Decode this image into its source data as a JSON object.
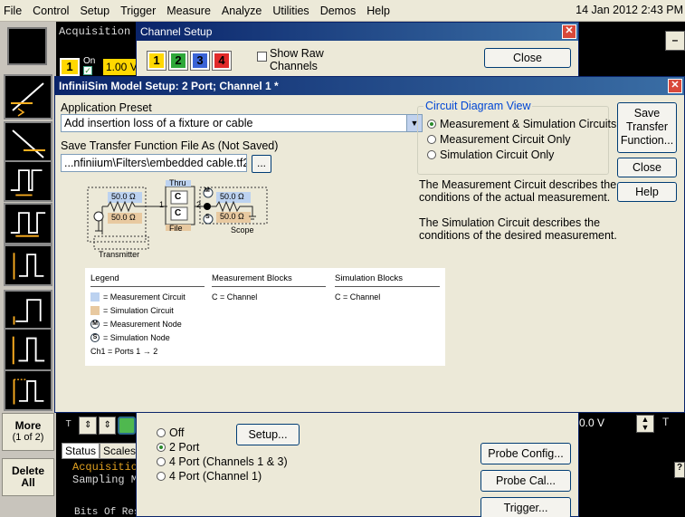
{
  "menu": {
    "items": [
      "File",
      "Control",
      "Setup",
      "Trigger",
      "Measure",
      "Analyze",
      "Utilities",
      "Demos",
      "Help"
    ],
    "datetime": "14 Jan 2012 2:43 PM"
  },
  "scope": {
    "acquisition_text": "Acquisition is",
    "ch1_number": "1",
    "ch1_on_label": "On",
    "ch1_scale": "1.00 V",
    "minimize": "–",
    "right_value": "0.0 V",
    "right_t": "T",
    "q_label": "?",
    "tabs": [
      "Status",
      "Scales"
    ],
    "status_lines": [
      "Acquisition",
      "Sampling Mo"
    ],
    "bits_line": "Bits Of Res"
  },
  "left_toolbar": {
    "more_label": "More",
    "more_sub": "(1 of 2)",
    "delete_label": "Delete",
    "delete_sub": "All"
  },
  "channel_setup": {
    "title": "Channel Setup",
    "channels": [
      "1",
      "2",
      "3",
      "4"
    ],
    "channel_colors": [
      "#ffd800",
      "#2ea83a",
      "#3a63d6",
      "#e12a2a"
    ],
    "show_raw_line1": "Show Raw",
    "show_raw_line2": "Channels",
    "close_label": "Close",
    "port_options": [
      "Off",
      "2 Port",
      "4 Port  (Channels 1 & 3)",
      "4 Port  (Channel 1)"
    ],
    "port_selected": "2 Port",
    "setup_label": "Setup...",
    "probe_config_label": "Probe Config...",
    "probe_cal_label": "Probe Cal...",
    "trigger_label": "Trigger..."
  },
  "infiniisim": {
    "title": "InfiniiSim Model Setup: 2 Port; Channel 1 *",
    "app_preset_label": "Application Preset",
    "app_preset_value": "Add insertion loss of a fixture or cable",
    "save_label": "Save Transfer Function File As (Not Saved)",
    "save_path": "...nfiniium\\Filters\\embedded cable.tf2",
    "browse_label": "...",
    "circuit_view_legend": "Circuit Diagram View",
    "circuit_view_options": [
      "Measurement & Simulation Circuits",
      "Measurement Circuit Only",
      "Simulation Circuit Only"
    ],
    "circuit_view_selected": "Measurement & Simulation Circuits",
    "save_tf_button": [
      "Save",
      "Transfer",
      "Function..."
    ],
    "close_label": "Close",
    "help_label": "Help",
    "measurement_desc": [
      "The Measurement Circuit describes the",
      "conditions of the actual measurement."
    ],
    "simulation_desc": [
      "The Simulation Circuit describes the",
      "conditions of the desired measurement."
    ],
    "diagram": {
      "transmitter_label": "Transmitter",
      "thru_label": "Thru",
      "file_label": "File",
      "scope_label": "Scope",
      "r_meas_tx": "50.0 Ω",
      "r_sim_tx": "50.0 Ω",
      "r_meas_scope": "50.0 Ω",
      "r_sim_scope": "50.0 Ω",
      "block_c": "C",
      "port1": "1",
      "port2": "2"
    },
    "legend": {
      "legend_header": "Legend",
      "meas_blocks_header": "Measurement Blocks",
      "sim_blocks_header": "Simulation Blocks",
      "items": [
        "= Measurement Circuit",
        "= Simulation Circuit",
        "= Measurement Node",
        "= Simulation Node",
        "Ch1 = Ports 1 → 2"
      ],
      "meas_block_value": "C = Channel",
      "sim_block_value": "C = Channel",
      "meas_color": "#bcd2f0",
      "sim_color": "#e8c9a0"
    }
  }
}
